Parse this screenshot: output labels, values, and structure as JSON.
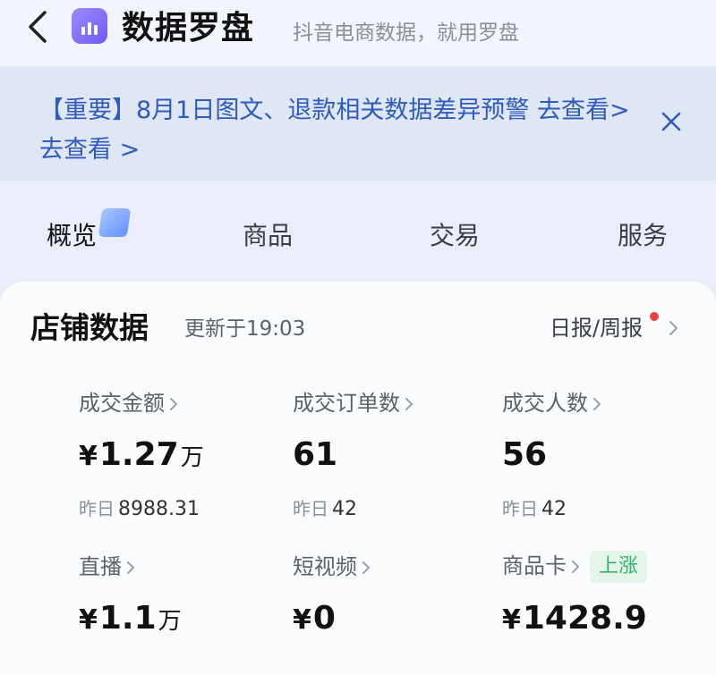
{
  "header": {
    "title": "数据罗盘",
    "subtitle": "抖音电商数据，就用罗盘"
  },
  "notice": {
    "text": "【重要】8月1日图文、退款相关数据差异预警 去查看> 去查看 >"
  },
  "tabs": [
    {
      "label": "概览",
      "active": true
    },
    {
      "label": "商品",
      "active": false
    },
    {
      "label": "交易",
      "active": false
    },
    {
      "label": "服务",
      "active": false
    }
  ],
  "store_card": {
    "title": "店铺数据",
    "updated": "更新于19:03",
    "report_link": "日报/周报",
    "metrics": [
      {
        "label": "成交金额",
        "currency": "¥",
        "value": "1.27",
        "unit": "万",
        "yesterday_label": "昨日",
        "yesterday_value": "8988.31"
      },
      {
        "label": "成交订单数",
        "currency": "",
        "value": "61",
        "unit": "",
        "yesterday_label": "昨日",
        "yesterday_value": "42"
      },
      {
        "label": "成交人数",
        "currency": "",
        "value": "56",
        "unit": "",
        "yesterday_label": "昨日",
        "yesterday_value": "42"
      },
      {
        "label": "直播",
        "currency": "¥",
        "value": "1.1",
        "unit": "万"
      },
      {
        "label": "短视频",
        "currency": "¥",
        "value": "0",
        "unit": ""
      },
      {
        "label": "商品卡",
        "currency": "¥",
        "value": "1428.9",
        "unit": "",
        "badge": "上涨"
      }
    ]
  },
  "colors": {
    "accent_blue": "#2f5bbd",
    "badge_green": "#2fb26a",
    "alert_red": "#f0423c",
    "logo_purple": "#7b68f5"
  }
}
